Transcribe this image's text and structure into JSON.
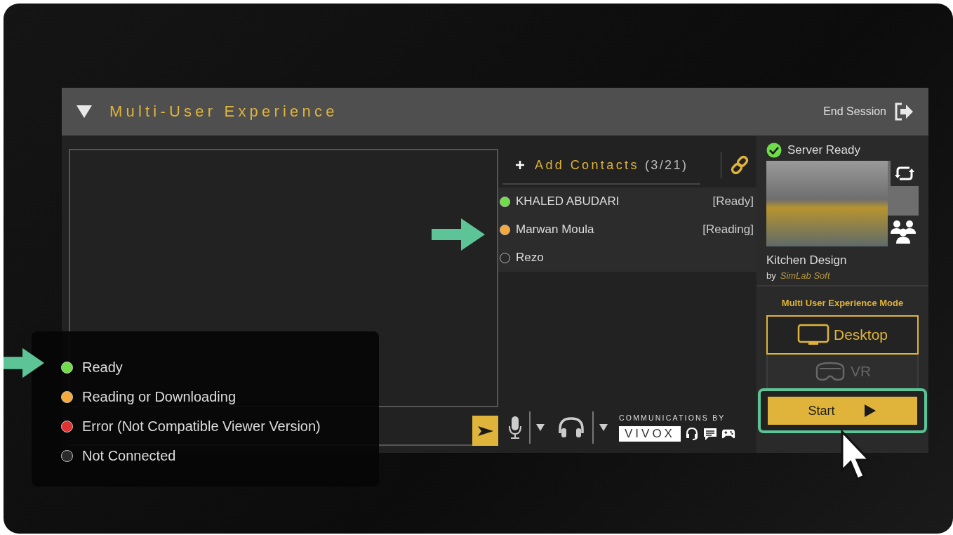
{
  "panel": {
    "title": "Multi-User Experience",
    "end_session": "End Session"
  },
  "contacts_header": {
    "add_label": "Add Contacts",
    "count": "(3/21)"
  },
  "contacts": [
    {
      "name": "KHALED ABUDARI",
      "status": "[Ready]",
      "color": "#6fdc4a"
    },
    {
      "name": "Marwan Moula",
      "status": "[Reading]",
      "color": "#f5a93a"
    },
    {
      "name": "Rezo",
      "color": "#2a2a2a"
    }
  ],
  "communications": {
    "caption": "COMMUNICATIONS BY",
    "brand": "VIVOX"
  },
  "server": {
    "status": "Server Ready",
    "project_name": "Kitchen Design",
    "by": "by",
    "author": "SimLab Soft"
  },
  "mode": {
    "title": "Multi User Experience Mode",
    "options": [
      {
        "label": "Desktop",
        "kind": "desktop",
        "selected": true
      },
      {
        "label": "VR",
        "kind": "vr",
        "selected": false
      }
    ]
  },
  "start_label": "Start",
  "legend": [
    {
      "label": "Ready",
      "color": "#6fdc4a"
    },
    {
      "label": "Reading or Downloading",
      "color": "#f5a93a"
    },
    {
      "label": "Error (Not Compatible Viewer Version)",
      "color": "#e03232"
    },
    {
      "label": "Not Connected",
      "color": "#2a2a2a"
    }
  ]
}
